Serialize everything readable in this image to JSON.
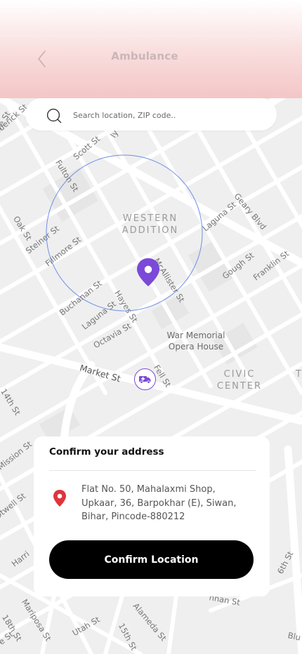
{
  "header": {
    "title": "Ambulance",
    "back_icon": "chevron-left-icon"
  },
  "search": {
    "placeholder": "Search location, ZIP code..",
    "icon": "search-icon"
  },
  "map": {
    "streets": [
      "Fulton St",
      "Scott St",
      "Oak St",
      "Steiner St",
      "Fillmore St",
      "Laguna St",
      "Geary Blvd",
      "Gough St",
      "Franklin St",
      "McAllister St",
      "Buchanan St",
      "Hayes St",
      "Laguna St",
      "Octavia St",
      "Fell St",
      "Market St",
      "14th St",
      "Mission St",
      "Otwell St",
      "Harri",
      "Mariposa St",
      "18th St",
      "Utah St",
      "15th St",
      "Alameda St",
      "nnan St",
      "6th St",
      "Blu",
      "re St",
      "oderick St",
      "ly St"
    ],
    "areas": [
      {
        "line1": "WESTERN",
        "line2": "ADDITION"
      },
      {
        "line1": "CIVIC",
        "line2": "CENTER"
      }
    ],
    "poi": {
      "line1": "War Memorial",
      "line2": "Opera House"
    },
    "edge_label": "T",
    "pin_icon": "location-pin-icon",
    "ambulance_icon": "ambulance-icon",
    "accent": "#7b49d8"
  },
  "sheet": {
    "title": "Confirm your address",
    "address_icon": "map-marker-icon",
    "address_lines": [
      "Flat No. 50, Mahalaxmi Shop,",
      "Upkaar, 36, Barpokhar (E), Siwan,",
      "Bihar, Pincode-880212"
    ],
    "confirm_label": "Confirm Location",
    "marker_color": "#e0343c"
  }
}
